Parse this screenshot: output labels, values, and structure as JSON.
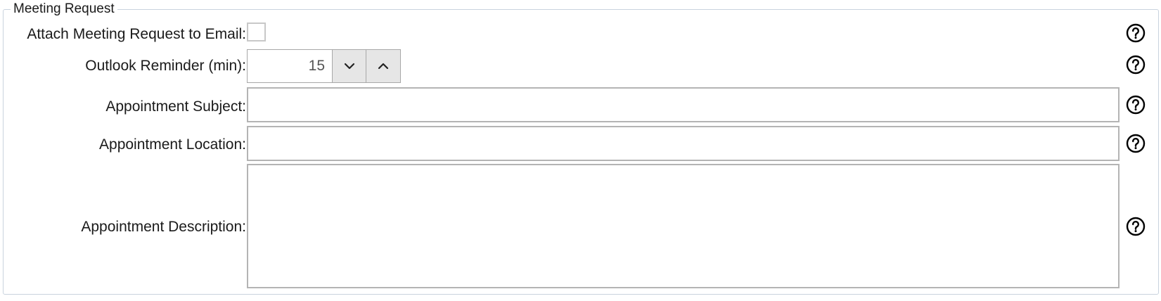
{
  "group": {
    "title": "Meeting Request"
  },
  "fields": {
    "attach": {
      "label": "Attach Meeting Request to Email:",
      "checked": false
    },
    "reminder": {
      "label": "Outlook Reminder (min):",
      "value": "15"
    },
    "subject": {
      "label": "Appointment Subject:",
      "value": ""
    },
    "location": {
      "label": "Appointment Location:",
      "value": ""
    },
    "description": {
      "label": "Appointment Description:",
      "value": ""
    }
  },
  "icons": {
    "help": "question-circle-icon",
    "decrement": "chevron-down-icon",
    "increment": "chevron-up-icon"
  }
}
